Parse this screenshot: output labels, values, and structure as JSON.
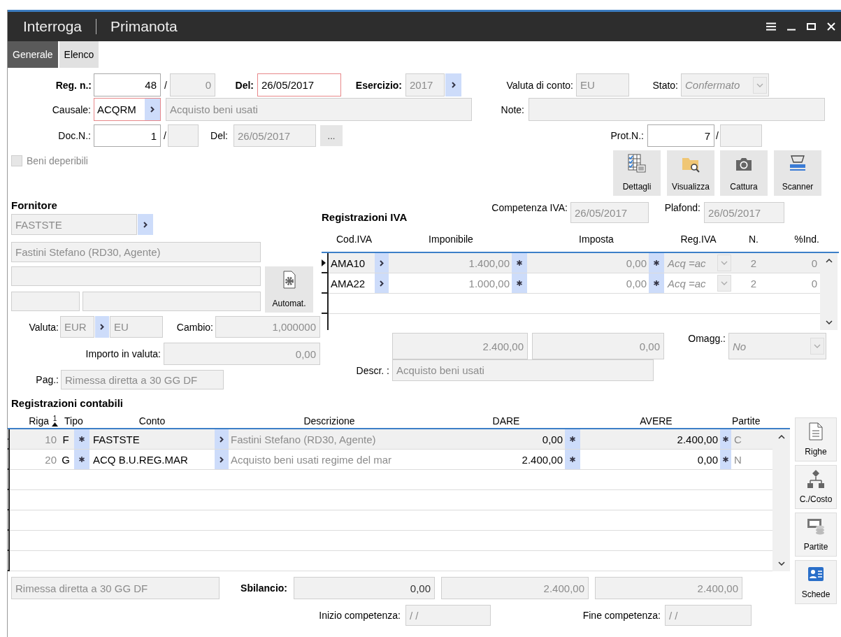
{
  "window": {
    "title": "Interroga",
    "document": "Primanota"
  },
  "tabs": [
    {
      "label": "Generale",
      "selected": true
    },
    {
      "label": "Elenco",
      "selected": false
    }
  ],
  "header": {
    "reg_label": "Reg. n.:",
    "reg_number": "48",
    "reg_separator": "/",
    "reg_suffix": "0",
    "date_label": "Del:",
    "date": "26/05/2017",
    "year_label": "Esercizio:",
    "year": "2017",
    "account_currency_label": "Valuta di conto:",
    "account_currency": "EU",
    "status_label": "Stato:",
    "status": "Confermato",
    "causale_label": "Causale:",
    "causale": "ACQRM",
    "causale_description": "Acquisto beni usati",
    "note_label": "Note:",
    "doc_label": "Doc.N.:",
    "doc_number": "1",
    "doc_separator": "/",
    "doc_date_label": "Del:",
    "doc_date": "26/05/2017",
    "browse": "...",
    "prot_label": "Prot.N.:",
    "prot_number": "7",
    "prot_separator": "/"
  },
  "perishable": {
    "label": "Beni deperibili",
    "checked": false
  },
  "toolbar": [
    {
      "label": "Dettagli",
      "kind": "checklist"
    },
    {
      "label": "Visualizza",
      "kind": "folder"
    },
    {
      "label": "Cattura",
      "kind": "camera"
    },
    {
      "label": "Scanner",
      "kind": "scanner"
    }
  ],
  "supplier": {
    "title": "Fornitore",
    "code": "FASTSTE",
    "name": "Fastini Stefano (RD30, Agente)",
    "automatic": "Automat.",
    "currency_label": "Valuta:",
    "currency": "EUR",
    "currency_short": "EU",
    "rate_label": "Cambio:",
    "rate": "1,000000",
    "amount_label": "Importo in valuta:",
    "amount": "0,00",
    "payment_label": "Pag.:",
    "payment": "Rimessa diretta a 30 GG DF"
  },
  "vat": {
    "title": "Registrazioni IVA",
    "competence_label": "Competenza IVA:",
    "competence": "26/05/2017",
    "plafond_label": "Plafond:",
    "plafond": "26/05/2017",
    "columns": [
      "Cod.IVA",
      "Imponibile",
      "Imposta",
      "Reg.IVA",
      "N.",
      "%Ind."
    ],
    "rows": [
      {
        "code": "AMA10",
        "taxable": "1.400,00",
        "tax": "0,00",
        "register": "Acq =ac",
        "n": "2",
        "non_deductible": "0",
        "selected": true
      },
      {
        "code": "AMA22",
        "taxable": "1.000,00",
        "tax": "0,00",
        "register": "Acq =ac",
        "n": "2",
        "non_deductible": "0",
        "selected": false
      }
    ],
    "total_taxable": "2.400,00",
    "total_tax": "0,00",
    "gift_label": "Omagg.:",
    "gift": "No",
    "description_label": "Descr. :",
    "description": "Acquisto beni usati"
  },
  "ledger": {
    "title": "Registrazioni contabili",
    "sort_order": "1",
    "columns": [
      "Riga",
      "Tipo",
      "Conto",
      "Descrizione",
      "DARE",
      "AVERE",
      "Partite"
    ],
    "rows": [
      {
        "line": "10",
        "type": "F",
        "account": "FASTSTE",
        "description": "Fastini Stefano (RD30, Agente)",
        "debit": "0,00",
        "credit": "2.400,00",
        "items": "C",
        "selected": true
      },
      {
        "line": "20",
        "type": "G",
        "account": "ACQ B.U.REG.MAR",
        "description": "Acquisto beni usati regime del mar",
        "debit": "2.400,00",
        "credit": "0,00",
        "items": "N",
        "selected": false
      }
    ]
  },
  "side_buttons": [
    {
      "label": "Righe",
      "kind": "document"
    },
    {
      "label": "C./Costo",
      "kind": "hierarchy"
    },
    {
      "label": "Partite",
      "kind": "coins"
    },
    {
      "label": "Schede",
      "kind": "contact"
    }
  ],
  "footer": {
    "payment": "Rimessa diretta a 30 GG DF",
    "imbalance_label": "Sbilancio:",
    "imbalance": "0,00",
    "debit_total": "2.400,00",
    "credit_total": "2.400,00",
    "start_label": "Inizio competenza:",
    "start": " /  /",
    "end_label": "Fine competenza:",
    "end": " /  /"
  }
}
